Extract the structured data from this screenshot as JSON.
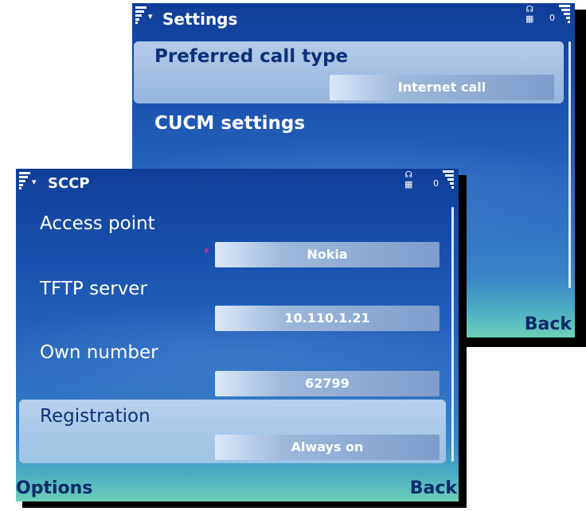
{
  "settings": {
    "title": "Settings",
    "status_zero": "0",
    "rows": [
      {
        "label": "Preferred call type",
        "value": "Internet call"
      },
      {
        "label": "CUCM settings"
      }
    ],
    "right_softkey": "Back"
  },
  "sccp": {
    "title": "SCCP",
    "status_zero": "0",
    "rows": [
      {
        "label": "Access point",
        "value": "Nokia",
        "required_mark": "*"
      },
      {
        "label": "TFTP server",
        "value": "10.110.1.21"
      },
      {
        "label": "Own number",
        "value": "62799"
      },
      {
        "label": "Registration",
        "value": "Always on"
      }
    ],
    "left_softkey": "Options",
    "right_softkey": "Back"
  },
  "colors": {
    "background_top": "#0f3e98",
    "background_bottom": "#6cd0b8",
    "highlight": "#d2e1f5",
    "softkey_text": "#0b2a6a"
  }
}
